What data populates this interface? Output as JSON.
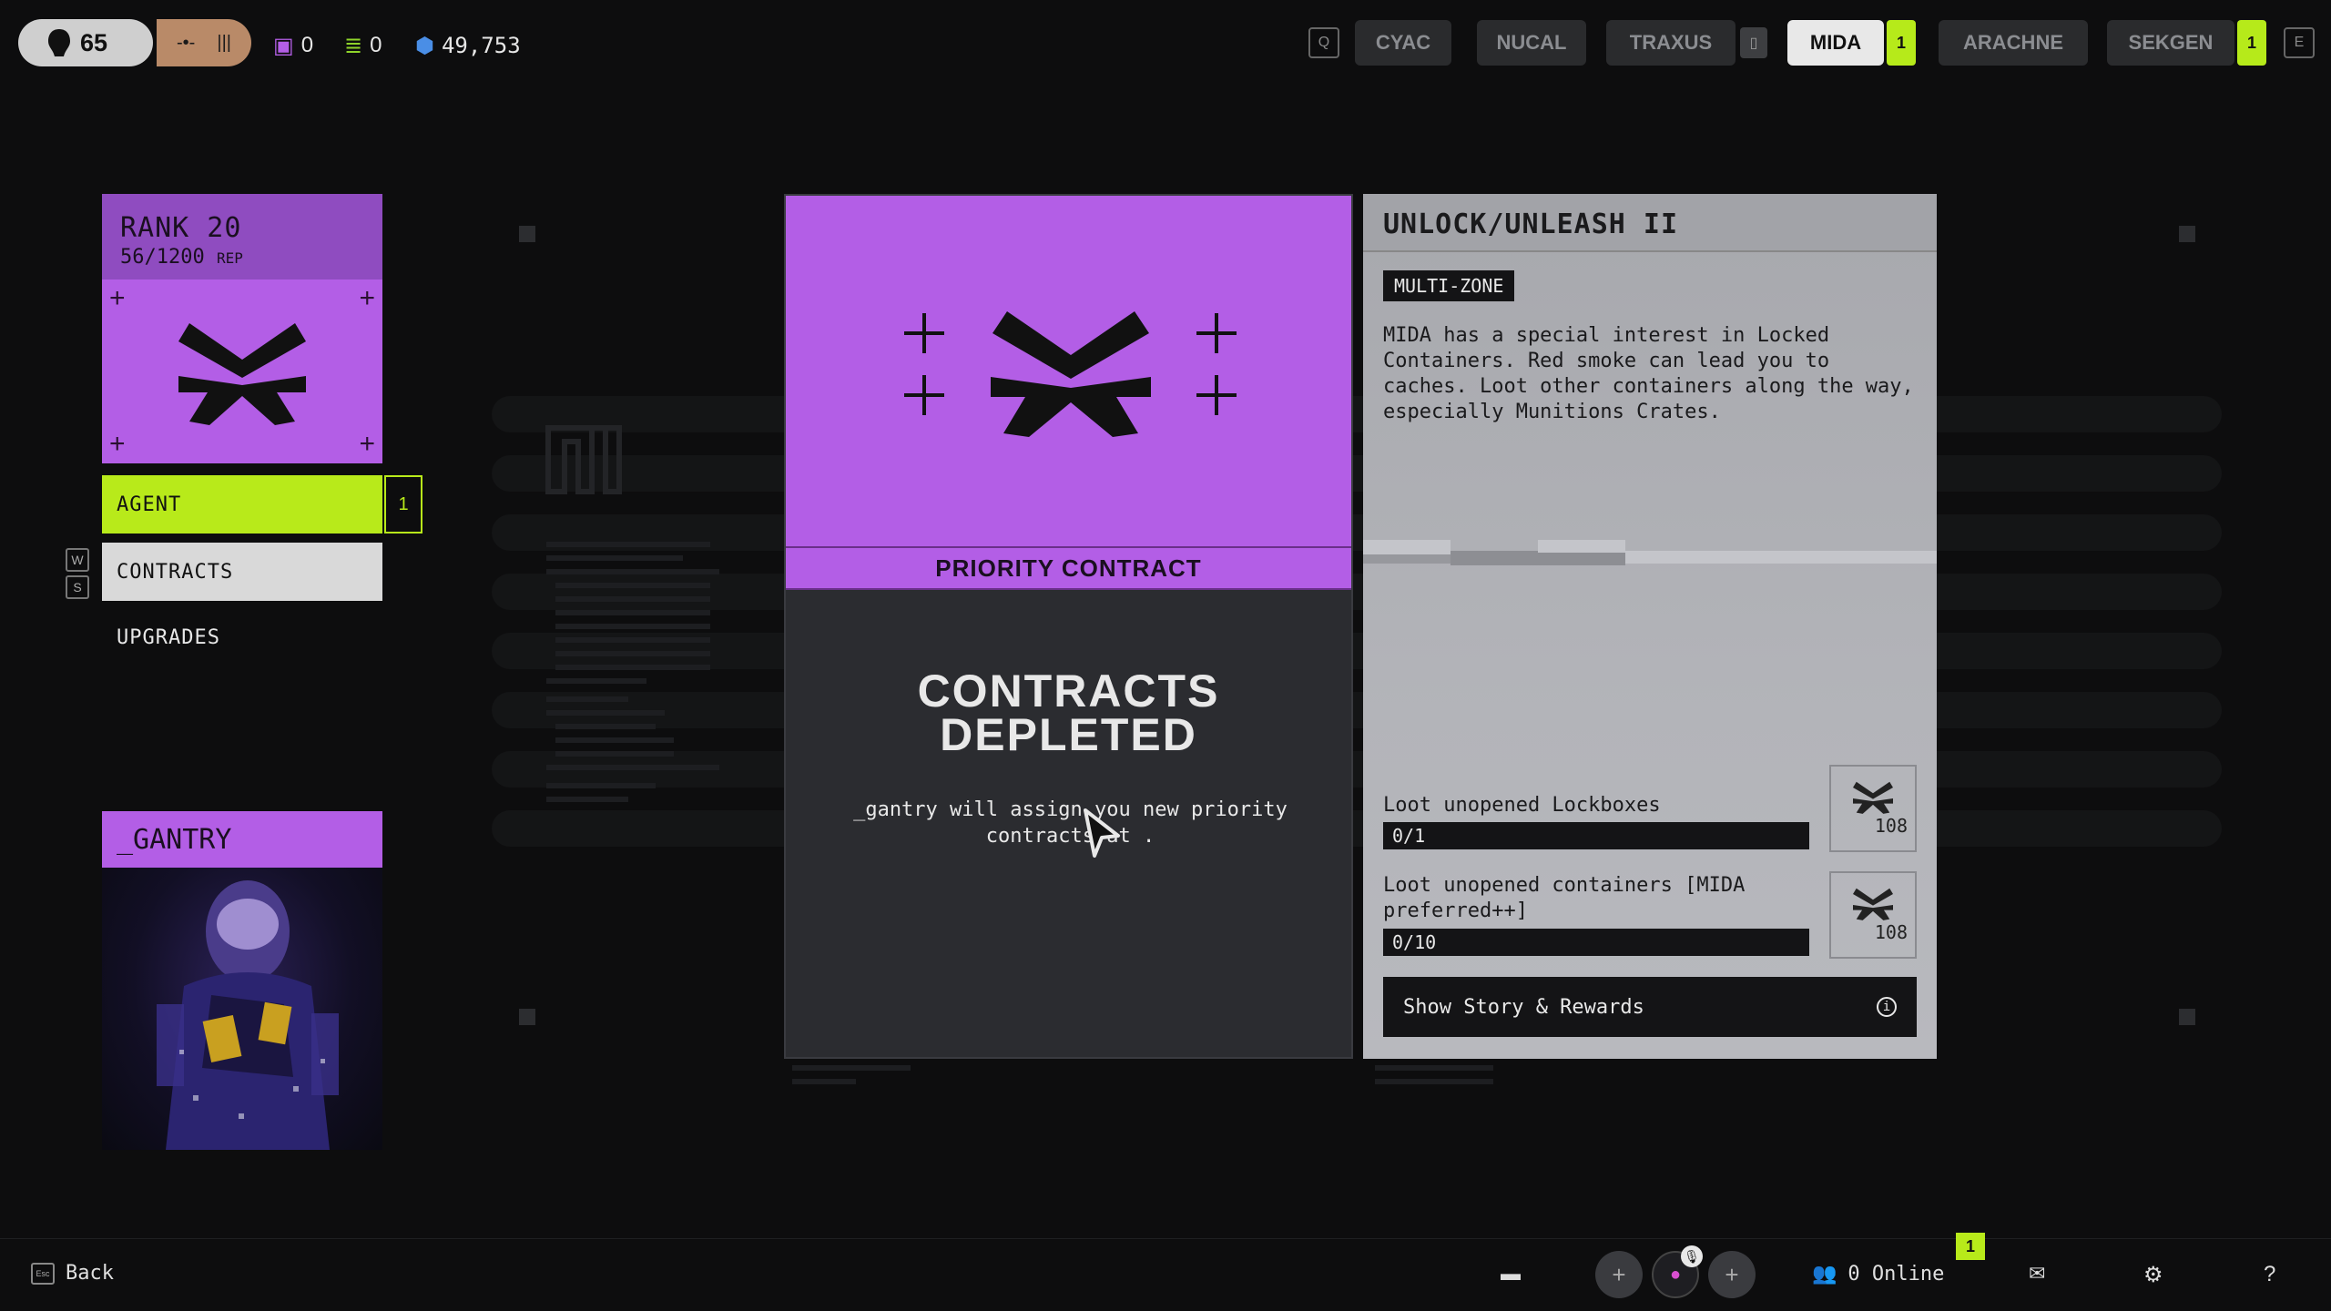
{
  "topbar": {
    "level": "65",
    "counters": [
      {
        "icon": "crate-icon",
        "value": "0"
      },
      {
        "icon": "stack-icon",
        "value": "0"
      },
      {
        "icon": "credits-icon",
        "value": "49,753"
      }
    ],
    "left_key": "Q",
    "right_key": "E",
    "factions": [
      {
        "name": "CYAC",
        "active": false,
        "badge": null
      },
      {
        "name": "NUCAL",
        "active": false,
        "badge": null
      },
      {
        "name": "TRAXUS",
        "active": false,
        "badge": null
      },
      {
        "name": "MIDA",
        "active": true,
        "badge": "1"
      },
      {
        "name": "ARACHNE",
        "active": false,
        "badge": null
      },
      {
        "name": "SEKGEN",
        "active": false,
        "badge": "1"
      }
    ]
  },
  "rank": {
    "title": "RANK 20",
    "rep_value": "56/1200",
    "rep_unit": "REP"
  },
  "nav": {
    "agent": "AGENT",
    "agent_badge": "1",
    "contracts": "CONTRACTS",
    "upgrades": "UPGRADES",
    "key_up": "W",
    "key_down": "S"
  },
  "agent_card": {
    "name": "_GANTRY"
  },
  "priority": {
    "strip": "PRIORITY CONTRACT",
    "title_line1": "CONTRACTS",
    "title_line2": "DEPLETED",
    "subtitle": "_gantry will assign you new priority contracts at ."
  },
  "contract": {
    "title": "UNLOCK/UNLEASH II",
    "tag": "MULTI-ZONE",
    "description": "MIDA has a special interest in Locked Containers. Red smoke can lead you to caches. Loot other containers along the way, especially Munitions Crates.",
    "objectives": [
      {
        "label": "Loot unopened Lockboxes",
        "progress": "0/1",
        "reward": "108"
      },
      {
        "label": "Loot unopened containers [MIDA preferred++]",
        "progress": "0/10",
        "reward": "108"
      }
    ],
    "story_button": "Show Story & Rewards"
  },
  "bottombar": {
    "back_key": "Esc",
    "back_label": "Back",
    "online": "0 Online",
    "online_badge": "1"
  },
  "colors": {
    "accent_purple": "#b35ee6",
    "accent_green": "#b8ea1a"
  }
}
